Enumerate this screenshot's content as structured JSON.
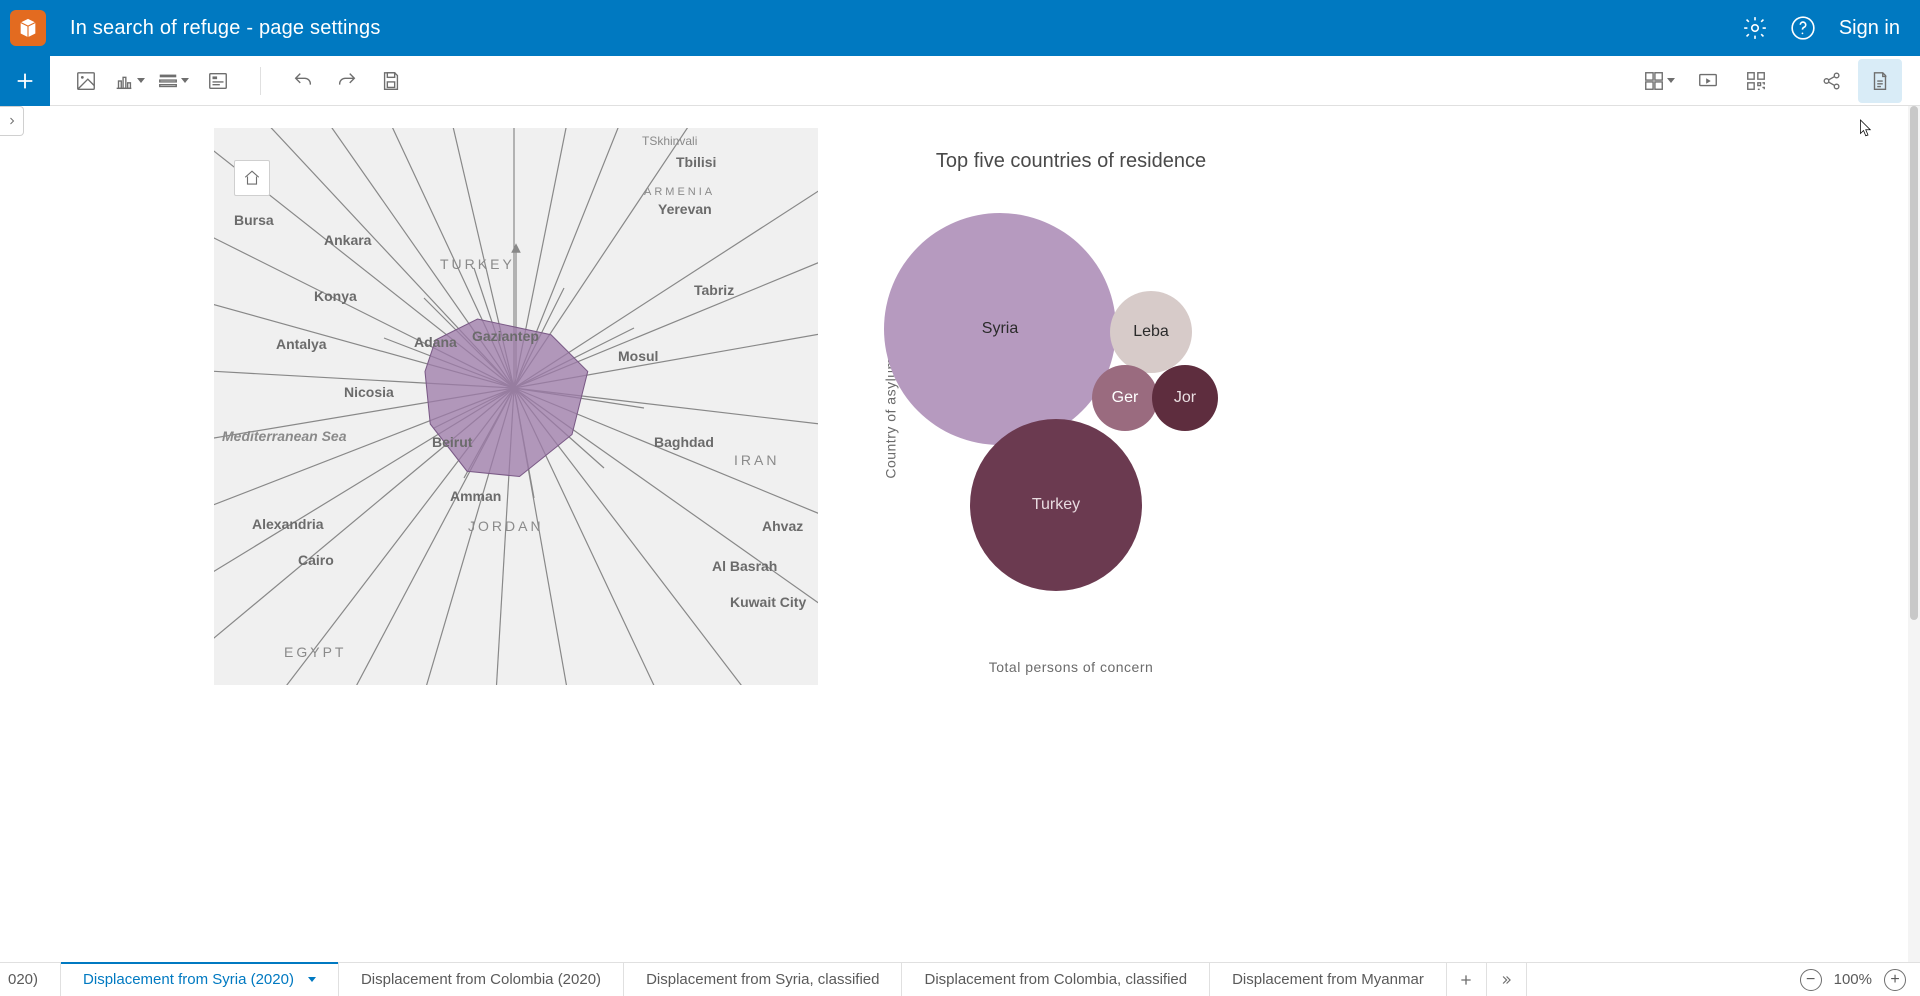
{
  "header": {
    "title": "In search of refuge - page settings",
    "signin": "Sign in"
  },
  "map": {
    "labels": {
      "tskhinvali": "TSkhinvali",
      "tbilisi": "Tbilisi",
      "armenia": "ARMENIA",
      "yerevan": "Yerevan",
      "bursa": "Bursa",
      "ankara": "Ankara",
      "turkey_region": "TURKEY",
      "konya": "Konya",
      "tabriz": "Tabriz",
      "antalya": "Antalya",
      "adana": "Adana",
      "gaziantep": "Gaziantep",
      "mosul": "Mosul",
      "nicosia": "Nicosia",
      "beirut": "Beirut",
      "baghdad": "Baghdad",
      "iran_region": "IRAN",
      "med_sea": "Mediterranean Sea",
      "amman": "Amman",
      "jordan_region": "JORDAN",
      "alexandria": "Alexandria",
      "ahvaz": "Ahvaz",
      "cairo": "Cairo",
      "albasrah": "Al Basrah",
      "kuwait": "Kuwait City",
      "egypt_region": "EGYPT"
    }
  },
  "bubble": {
    "title": "Top five countries of residence",
    "y_label": "Country of asylum",
    "x_label": "Total persons of concern"
  },
  "chart_data": {
    "type": "bubble",
    "title": "Top five countries of residence",
    "xlabel": "Total persons of concern",
    "ylabel": "Country of asylum",
    "series": [
      {
        "name": "Syria",
        "label": "Syria",
        "radius_px": 116,
        "color": "#b69abf"
      },
      {
        "name": "Turkey",
        "label": "Turkey",
        "radius_px": 86,
        "color": "#6b3a50"
      },
      {
        "name": "Lebanon",
        "label": "Leba",
        "radius_px": 41,
        "color": "#d7cbc9"
      },
      {
        "name": "Germany",
        "label": "Ger",
        "radius_px": 33,
        "color": "#9a6b7f"
      },
      {
        "name": "Jordan",
        "label": "Jor",
        "radius_px": 33,
        "color": "#5e2d3e"
      }
    ]
  },
  "tabs": {
    "partial": "020)",
    "active": "Displacement from Syria (2020)",
    "t2": "Displacement from Colombia (2020)",
    "t3": "Displacement from Syria, classified",
    "t4": "Displacement from Colombia, classified",
    "t5": "Displacement from Myanmar"
  },
  "zoom": {
    "level": "100%"
  }
}
